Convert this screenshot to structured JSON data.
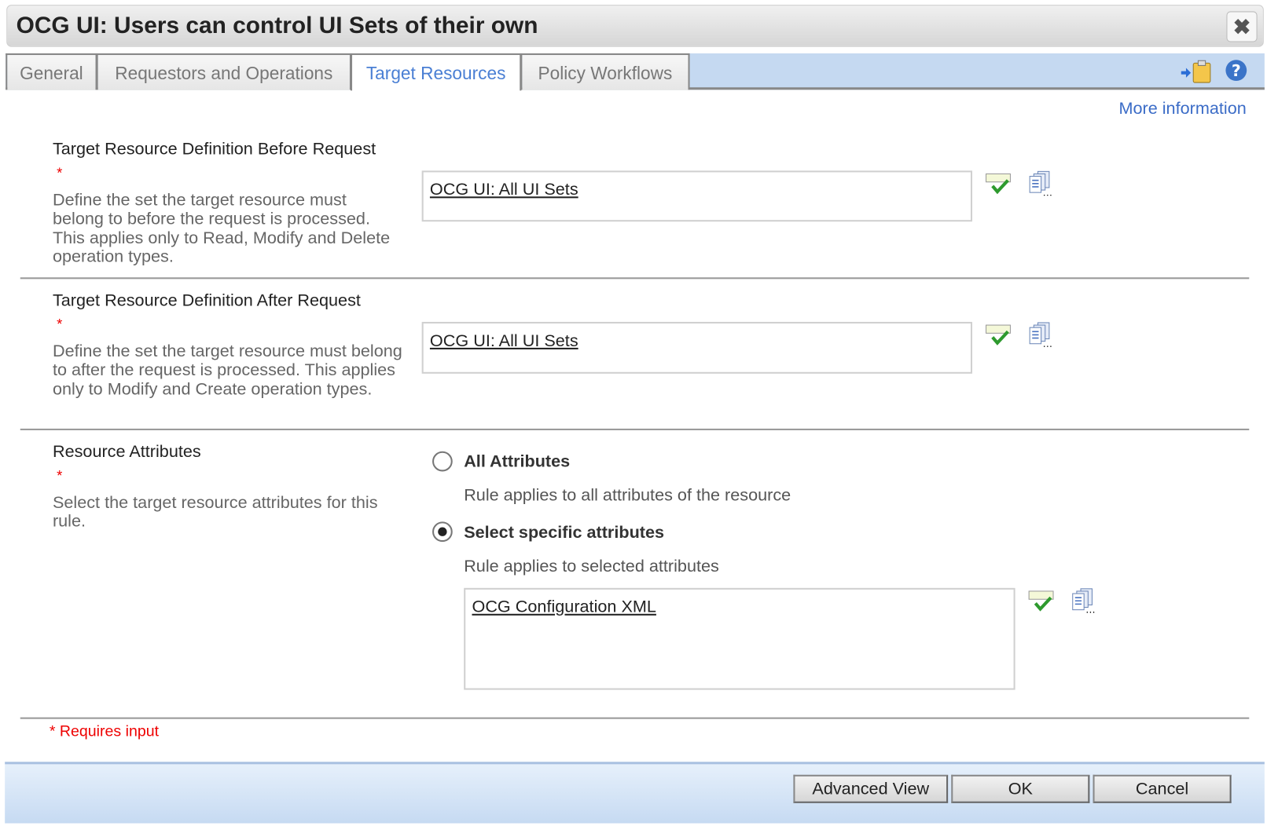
{
  "window": {
    "title": "OCG UI: Users can control UI Sets of their own",
    "close_icon": "close-x-icon"
  },
  "tabs": [
    {
      "label": "General",
      "selected": false
    },
    {
      "label": "Requestors and Operations",
      "selected": false
    },
    {
      "label": "Target Resources",
      "selected": true
    },
    {
      "label": "Policy Workflows",
      "selected": false
    }
  ],
  "toolbar": {
    "icons": [
      "paste-clipboard-icon",
      "help-icon"
    ]
  },
  "more_information": "More information",
  "sections": [
    {
      "label": "Target Resource Definition Before Request",
      "required": "*",
      "description": "Define the set the target resource must belong to before the request is processed. This applies only to Read, Modify and Delete operation types.",
      "value": "OCG UI: All UI Sets"
    },
    {
      "label": "Target Resource Definition After Request",
      "required": "*",
      "description": "Define the set the target resource must belong to after the request is processed. This applies only to Modify and Create operation types.",
      "value": "OCG UI: All UI Sets"
    },
    {
      "label": "Resource Attributes",
      "required": "*",
      "description": "Select the target resource attributes for this rule.",
      "options": [
        {
          "label": "All Attributes",
          "description": "Rule applies to all attributes of the resource",
          "selected": false
        },
        {
          "label": "Select specific attributes",
          "description": "Rule applies to selected attributes",
          "selected": true
        }
      ],
      "value": "OCG Configuration XML"
    }
  ],
  "requires_input": "* Requires input",
  "buttons": {
    "advanced": "Advanced View",
    "ok": "OK",
    "cancel": "Cancel"
  },
  "colors": {
    "accent": "#3b6cc7",
    "tabbar": "#c5d9f1",
    "required": "#e00000"
  }
}
